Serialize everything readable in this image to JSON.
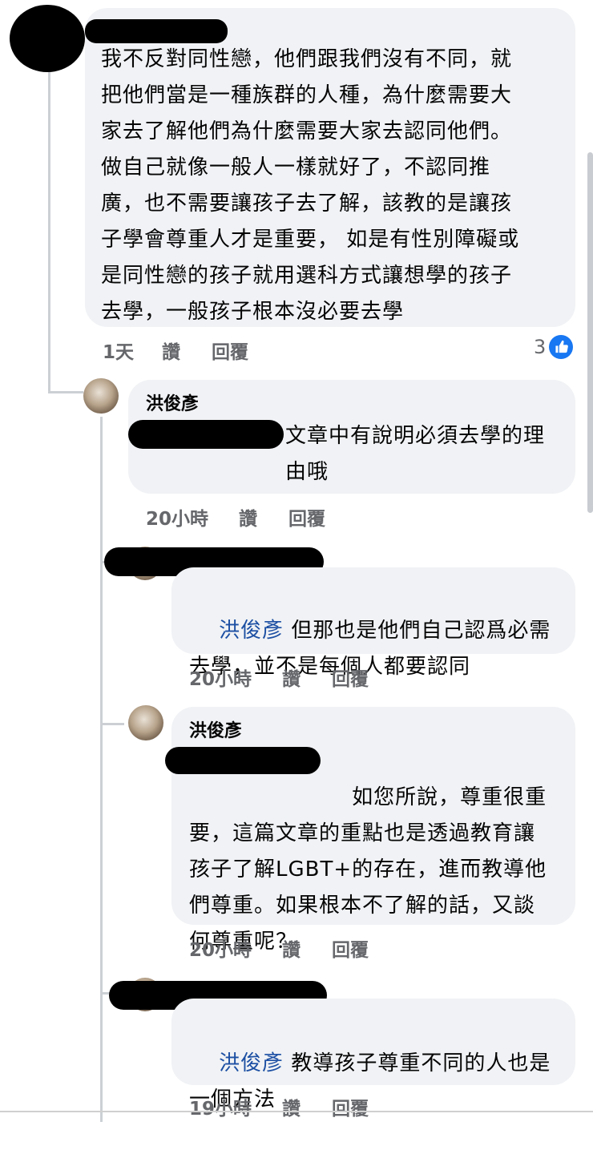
{
  "top_comment": {
    "text": "我不反對同性戀，他們跟我們沒有不同，就\n把他們當是一種族群的人種，為什麼需要大\n家去了解他們為什麼需要大家去認同他們。\n做自己就像一般人一樣就好了，不認同推\n廣，也不需要讓孩子去了解，該教的是讓孩\n子學會尊重人才是重要， 如是有性別障礙或\n是同性戀的孩子就用選科方式讓想學的孩子\n去學，一般孩子根本沒必要去學",
    "time": "1天",
    "like": "讚",
    "reply": "回覆",
    "reaction_count": "3",
    "reaction_icon": "like-icon"
  },
  "reply1": {
    "author": "洪俊彥",
    "text": "文章中有說明必須去學的理\n由哦",
    "time": "20小時",
    "like": "讚",
    "reply": "回覆"
  },
  "reply2": {
    "mention": "洪俊彥",
    "text_line1": " 但那也是他們自己認爲必需",
    "text_rest": "去學，並不是每個人都要認同",
    "time": "20小時",
    "like": "讚",
    "reply": "回覆"
  },
  "reply3": {
    "author": "洪俊彥",
    "text_line1": "如您所說，尊重很重",
    "text_rest": "要，這篇文章的重點也是透過教育讓\n孩子了解LGBT+的存在，進而教導他\n們尊重。如果根本不了解的話，又談\n何尊重呢？",
    "time": "20小時",
    "like": "讚",
    "reply": "回覆"
  },
  "reply4": {
    "mention": "洪俊彥",
    "text_line1": " 教導孩子尊重不同的人也是",
    "text_rest": "一個方法",
    "time": "19小時",
    "like": "讚",
    "reply": "回覆"
  },
  "colors": {
    "bubble": "#f0f2f5",
    "meta": "#65676b",
    "mention": "#1c4fa3",
    "like_blue": "#1877f2"
  }
}
